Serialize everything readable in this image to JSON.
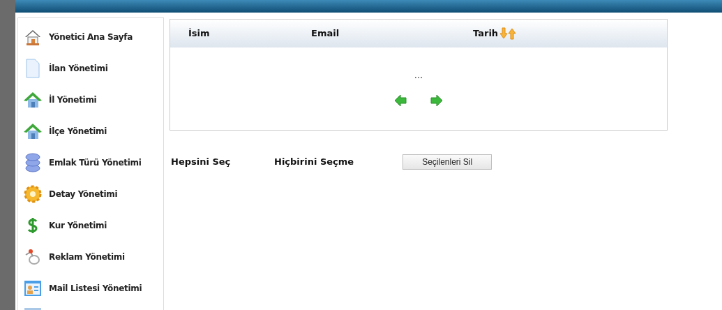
{
  "sidebar": {
    "items": [
      {
        "label": "Yönetici Ana Sayfa",
        "kind": "home"
      },
      {
        "label": "İlan Yönetimi",
        "kind": "document"
      },
      {
        "label": "İl Yönetimi",
        "kind": "house"
      },
      {
        "label": "İlçe Yönetimi",
        "kind": "house"
      },
      {
        "label": "Emlak Türü Yönetimi",
        "kind": "database"
      },
      {
        "label": "Detay Yönetimi",
        "kind": "gear"
      },
      {
        "label": "Kur Yönetimi",
        "kind": "dollar"
      },
      {
        "label": "Reklam Yönetimi",
        "kind": "pin"
      },
      {
        "label": "Mail Listesi Yönetimi",
        "kind": "contact"
      },
      {
        "kind": "window"
      }
    ]
  },
  "table": {
    "columns": [
      {
        "label": "İsim",
        "sortable": false
      },
      {
        "label": "Email",
        "sortable": false
      },
      {
        "label": "Tarih",
        "sortable": true
      }
    ],
    "placeholder_row": "...",
    "pager": [
      {
        "kind": "previous"
      },
      {
        "kind": "next"
      }
    ]
  },
  "actions": [
    {
      "label": "Hepsini Seç",
      "kind": "link"
    },
    {
      "label": "Hiçbirini Seçme",
      "kind": "link"
    },
    {
      "label": "Seçilenleri Sil",
      "kind": "button"
    }
  ]
}
